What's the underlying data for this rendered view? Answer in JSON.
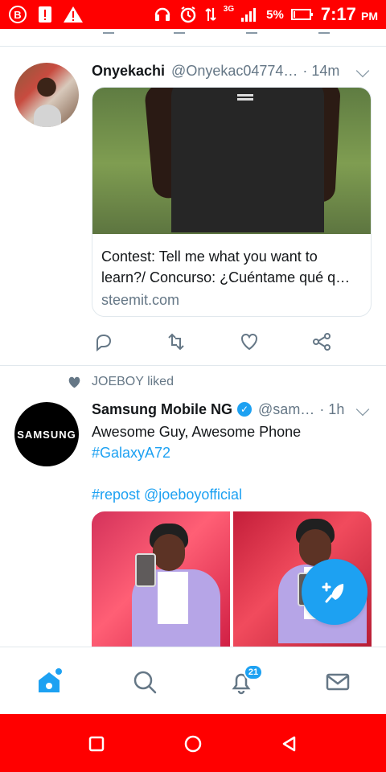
{
  "status": {
    "network": "3G",
    "battery": "5%",
    "time": "7:17",
    "ampm": "PM"
  },
  "tweets": [
    {
      "name": "Onyekachi",
      "handle": "@Onyekac04774…",
      "time": "· 14m",
      "card": {
        "title": "Contest: Tell me what you want to learn?/ Concurso: ¿Cuéntame qué q…",
        "domain": "steemit.com"
      }
    },
    {
      "liked_by": "JOEBOY liked",
      "name": "Samsung Mobile NG",
      "handle": "@sam…",
      "time": "· 1h",
      "avatar_text": "SAMSUNG",
      "text": "Awesome Guy, Awesome Phone",
      "hashtag": "#GalaxyA72",
      "repost": "#repost @joeboyofficial"
    }
  ],
  "navigation": {
    "notifications_count": "21"
  },
  "colors": {
    "accent": "#1da1f2",
    "system_bar": "#ff0000"
  },
  "icons": [
    "home-icon",
    "search-icon",
    "notifications-icon",
    "messages-icon",
    "compose-icon"
  ]
}
